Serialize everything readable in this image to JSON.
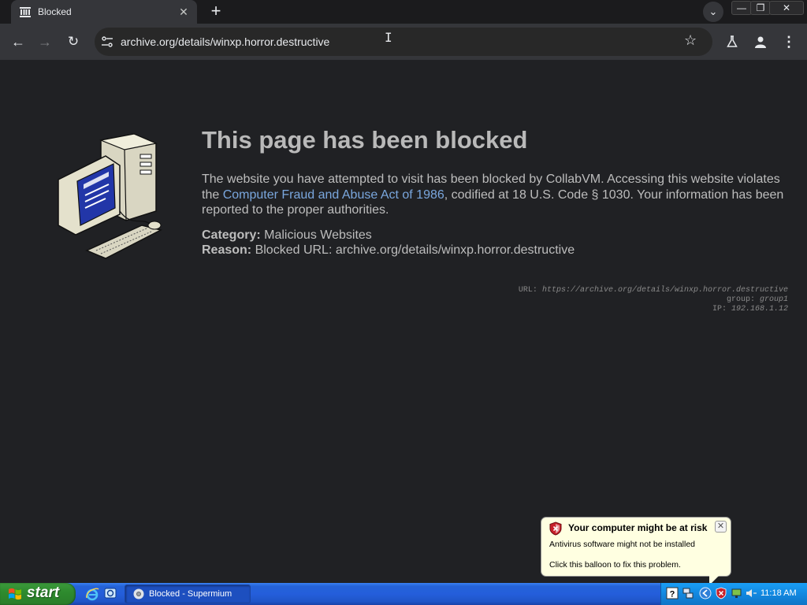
{
  "browser": {
    "tab_title": "Blocked",
    "url": "archive.org/details/winxp.horror.destructive",
    "window_buttons": {
      "minimize": "—",
      "restore": "❐",
      "close": "✕"
    }
  },
  "page": {
    "headline": "This page has been blocked",
    "body_before_link": "The website you have attempted to visit has been blocked by CollabVM. Accessing this website violates the ",
    "link_text": "Computer Fraud and Abuse Act of 1986",
    "body_after_link": ", codified at 18 U.S. Code § 1030. Your information has been reported to the proper authorities.",
    "category_label": "Category:",
    "category_value": "Malicious Websites",
    "reason_label": "Reason:",
    "reason_value": "Blocked URL: archive.org/details/winxp.horror.destructive",
    "meta": {
      "url_label": "URL:",
      "url_value": "https://archive.org/details/winxp.horror.destructive",
      "group_label": "group:",
      "group_value": "group1",
      "ip_label": "IP:",
      "ip_value": "192.168.1.12"
    }
  },
  "balloon": {
    "title": "Your computer might be at risk",
    "line1": "Antivirus software might not be installed",
    "line2": "Click this balloon to fix this problem."
  },
  "taskbar": {
    "start_label": "start",
    "task_label": "Blocked - Supermium",
    "clock": "11:18 AM"
  },
  "colors": {
    "link": "#7aa7de",
    "page_bg": "#202124",
    "balloon_bg": "#ffffe1",
    "taskbar_blue": "#245edb",
    "start_green": "#2e8b2e"
  },
  "icons": [
    "tab-favicon-icon",
    "close-icon",
    "plus-icon",
    "chevron-down-icon",
    "back-icon",
    "forward-icon",
    "reload-icon",
    "site-info-icon",
    "star-icon",
    "labs-icon",
    "profile-icon",
    "menu-icon",
    "shield-warning-icon",
    "windows-flag-icon",
    "ie-icon",
    "desktop-icon",
    "chrome-icon",
    "help-icon",
    "network-icon",
    "volume-icon"
  ]
}
